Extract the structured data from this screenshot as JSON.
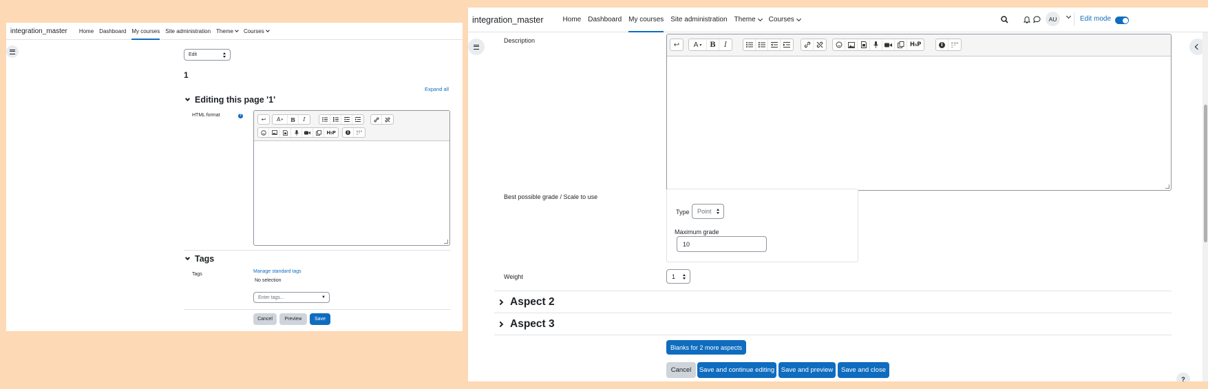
{
  "left": {
    "navbar": {
      "site_name": "integration_master",
      "items": [
        "Home",
        "Dashboard",
        "My courses",
        "Site administration",
        "Theme",
        "Courses"
      ]
    },
    "edit_select": "Edit",
    "page_number": "1",
    "expand_all": "Expand all",
    "section_title": "Editing this page '1'",
    "html_format_label": "HTML format",
    "tags_section": "Tags",
    "tags_label": "Tags",
    "manage_tags": "Manage standard tags",
    "no_selection": "No selection",
    "tags_placeholder": "Enter tags...",
    "buttons": {
      "cancel": "Cancel",
      "preview": "Preview",
      "save": "Save"
    }
  },
  "right": {
    "navbar": {
      "site_name": "integration_master",
      "items": [
        "Home",
        "Dashboard",
        "My courses",
        "Site administration",
        "Theme",
        "Courses"
      ],
      "avatar": "AU",
      "edit_mode": "Edit mode"
    },
    "description_label": "Description",
    "grade_label": "Best possible grade / Scale to use",
    "type_label": "Type",
    "type_value": "Point",
    "max_grade_label": "Maximum grade",
    "max_grade_value": "10",
    "weight_label": "Weight",
    "weight_value": "1",
    "aspect2": "Aspect 2",
    "aspect3": "Aspect 3",
    "blanks_button": "Blanks for 2 more aspects",
    "buttons": {
      "cancel": "Cancel",
      "save_continue": "Save and continue editing",
      "save_preview": "Save and preview",
      "save_close": "Save and close"
    },
    "help": "?"
  },
  "toolbar": {
    "undo": "↩",
    "font": "A",
    "bold": "B",
    "italic": "I",
    "h5p": "H₅P"
  },
  "colors": {
    "background": "#fdd9b5",
    "primary": "#0f6cbf",
    "secondary": "#ced4da"
  }
}
